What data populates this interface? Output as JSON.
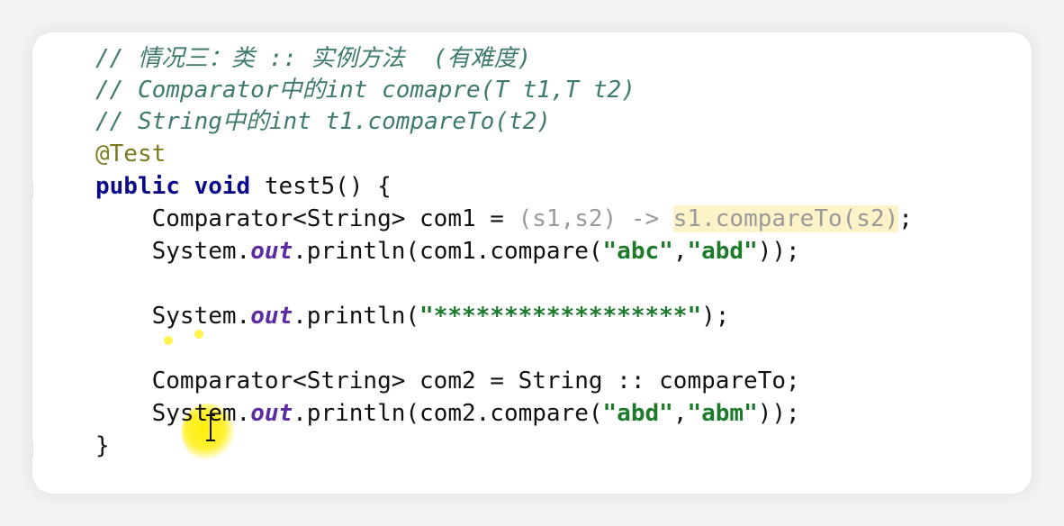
{
  "editor": {
    "lines": {
      "comment1": "// 情况三：类 :: 实例方法  (有难度)",
      "comment2": "// Comparator中的int comapre(T t1,T t2)",
      "comment3": "// String中的int t1.compareTo(t2)",
      "annotation": "@Test",
      "kw_public": "public",
      "kw_void": "void",
      "method_sig": " test5() {",
      "l1_a": "    Comparator<String> com1 = ",
      "l1_b": "(s1,s2) -> ",
      "l1_c": "s1.compareTo(s2)",
      "l1_d": ";",
      "l2_a": "    System.",
      "l2_out": "out",
      "l2_b": ".println(com1.compare(",
      "l2_s1": "\"abc\"",
      "l2_comma": ",",
      "l2_s2": "\"abd\"",
      "l2_c": "));",
      "l3_a": "    System.",
      "l3_out": "out",
      "l3_b": ".println(",
      "l3_s": "\"******************\"",
      "l3_c": ");",
      "l4": "    Comparator<String> com2 = String :: compareTo;",
      "l5_a": "    System.",
      "l5_out": "out",
      "l5_b": ".println(com2.compare(",
      "l5_s1": "\"abd\"",
      "l5_comma": ",",
      "l5_s2": "\"abm\"",
      "l5_c": "));",
      "close": "}"
    },
    "colors": {
      "comment": "#3f7a6e",
      "keyword": "#0a0a88",
      "string": "#1c7a2a",
      "static_field": "#5a2ca0",
      "highlight": "#fcf3c8",
      "cursor_highlight": "#ffee00"
    }
  }
}
